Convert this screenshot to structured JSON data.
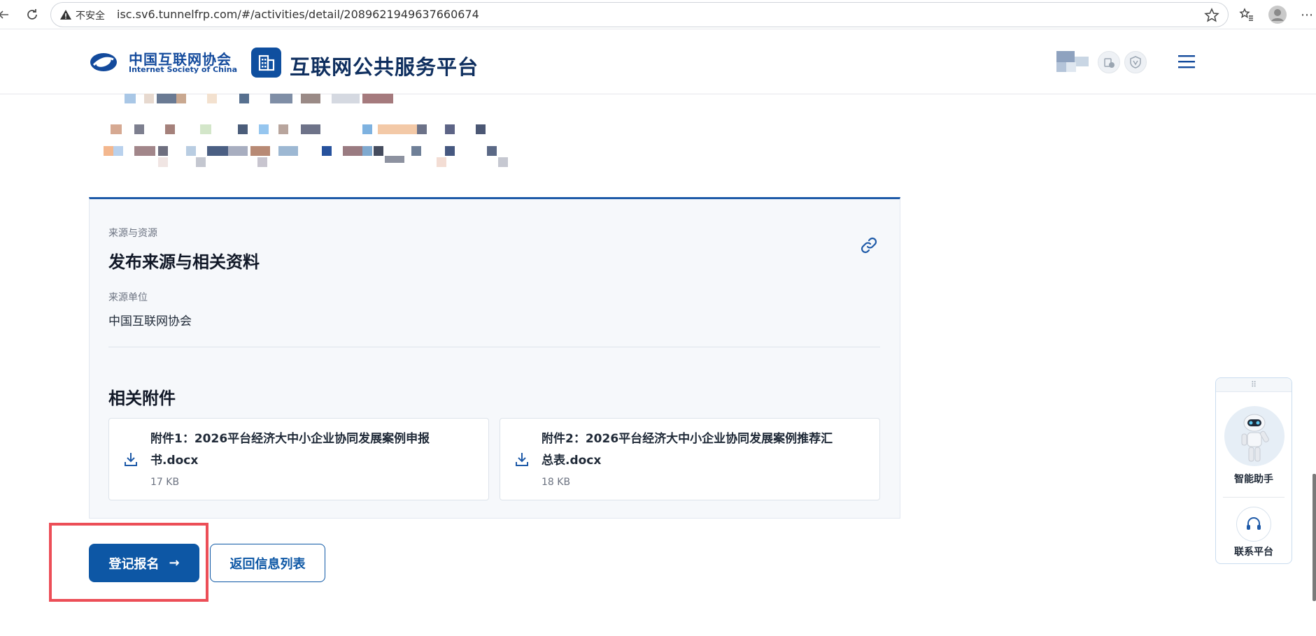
{
  "browser": {
    "security_label": "不安全",
    "url": "isc.sv6.tunnelfrp.com/#/activities/detail/2089621949637660674"
  },
  "header": {
    "org_name_cn": "中国互联网协会",
    "org_name_en": "Internet Society of China",
    "platform_title": "互联网公共服务平台"
  },
  "source_section": {
    "eyebrow": "来源与资源",
    "title": "发布来源与相关资料",
    "org_label": "来源单位",
    "org_value": "中国互联网协会"
  },
  "attachments": {
    "title": "相关附件",
    "items": [
      {
        "name": "附件1：2026平台经济大中小企业协同发展案例申报书.docx",
        "size": "17 KB"
      },
      {
        "name": "附件2：2026平台经济大中小企业协同发展案例推荐汇总表.docx",
        "size": "18 KB"
      }
    ]
  },
  "actions": {
    "register_label": "登记报名",
    "register_arrow": "→",
    "back_label": "返回信息列表"
  },
  "widget": {
    "assistant_label": "智能助手",
    "contact_label": "联系平台"
  },
  "colors": {
    "brand_blue": "#0d57a5",
    "highlight_red": "#ec4e57"
  }
}
